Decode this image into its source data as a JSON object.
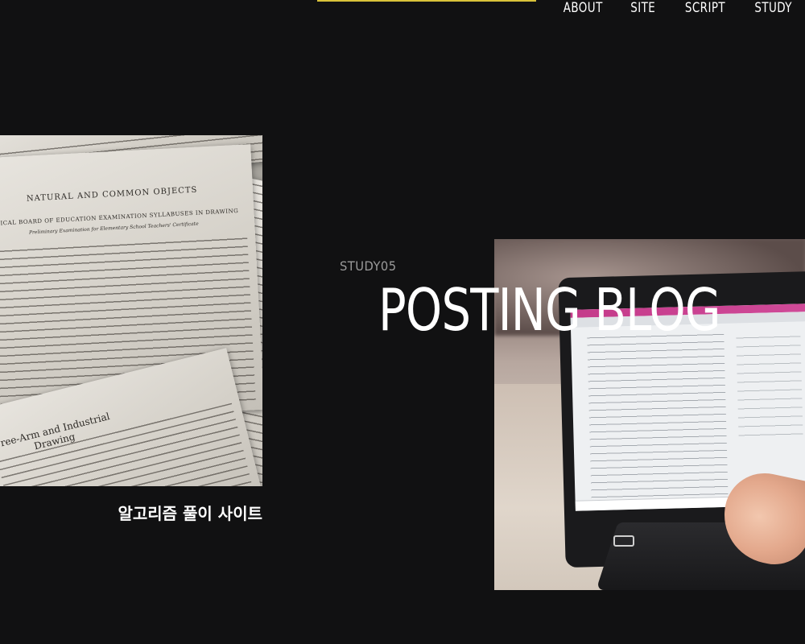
{
  "nav": {
    "items": [
      {
        "label": "ABOUT"
      },
      {
        "label": "SITE"
      },
      {
        "label": "SCRIPT"
      },
      {
        "label": "STUDY"
      }
    ]
  },
  "feature": {
    "kicker": "STUDY05",
    "title": "POSTING BLOG",
    "caption": "알고리즘 풀이 사이트"
  },
  "images": {
    "left_photo": {
      "heading_1": "NATURAL AND COMMON OBJECTS",
      "heading_2": "TYPICAL BOARD OF EDUCATION EXAMINATION SYLLABUSES IN DRAWING",
      "heading_3": "Preliminary Examination for Elementary School Teachers' Certificate",
      "bottom_heading": "Free-Arm and Industrial Drawing"
    }
  },
  "colors": {
    "background": "#111112",
    "accent": "#d9c23a",
    "text_primary": "#ffffff",
    "text_muted": "#9a9a9a"
  }
}
